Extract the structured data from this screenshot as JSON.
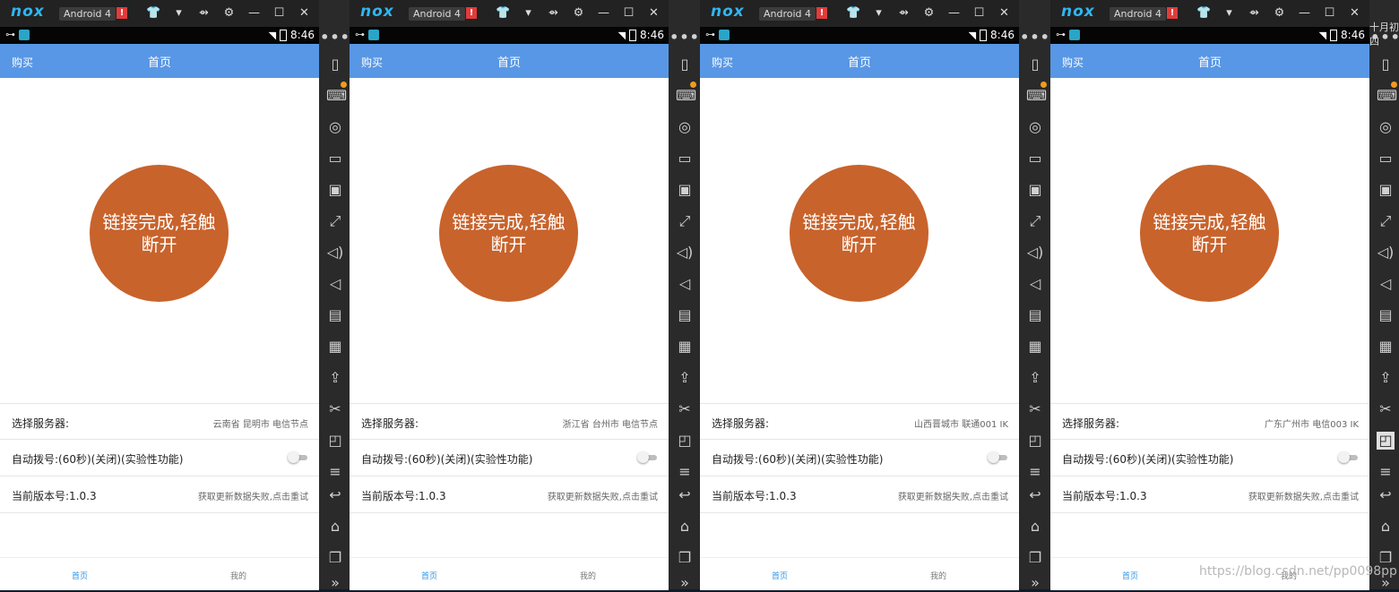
{
  "titlebar": {
    "logo": "nox",
    "android_version": "Android 4",
    "warn": "!",
    "icons": [
      "shirt-icon",
      "chevron-down-icon",
      "pin-icon",
      "gear-icon",
      "minimize-icon",
      "maximize-icon",
      "close-icon"
    ],
    "glyphs": [
      "👕",
      "▾",
      "⇴",
      "⚙",
      "—",
      "☐",
      "✕"
    ]
  },
  "statusbar": {
    "time": "8:46"
  },
  "app": {
    "buy": "购买",
    "title": "首页",
    "connect_text": "链接完成,轻触断开",
    "server_label": "选择服务器:",
    "autodial_label": "自动拨号:(60秒)(关闭)(实验性功能)",
    "version_label": "当前版本号:1.0.3",
    "update_text": "获取更新数据失败,点击重试",
    "nav_home": "首页",
    "nav_mine": "我的"
  },
  "windows": [
    {
      "server": "云南省 昆明市 电信节点"
    },
    {
      "server": "浙江省 台州市 电信节点"
    },
    {
      "server": "山西晋城市 联通001 IK"
    },
    {
      "server": "广东广州市 电信003 IK"
    }
  ],
  "sidebar": {
    "more": "•••",
    "icons": [
      "phone-shake-icon",
      "keyboard-icon",
      "location-icon",
      "screen-icon",
      "record-icon",
      "fullscreen-icon",
      "volume-up-icon",
      "volume-down-icon",
      "toolbox-icon",
      "macro-icon",
      "apk-install-icon",
      "scissors-icon",
      "multi-window-icon",
      "menu-icon",
      "back-icon",
      "home-icon",
      "recent-apps-icon",
      "expand-icon"
    ],
    "glyphs": [
      "▯",
      "⌨",
      "◎",
      "▭",
      "▣",
      "⤢",
      "◁)",
      "◁",
      "▤",
      "▦",
      "⇪",
      "✂",
      "◰",
      "≡",
      "↩",
      "⌂",
      "❐",
      "»"
    ]
  },
  "colors": {
    "appbar": "#5897e5",
    "circle": "#c8632c",
    "nav_active": "#2f95e6",
    "titlebar": "#222222",
    "sidebar": "#2a2a2a"
  },
  "watermark": "https://blog.csdn.net/pp0098pp",
  "corner_text": "十月初四"
}
